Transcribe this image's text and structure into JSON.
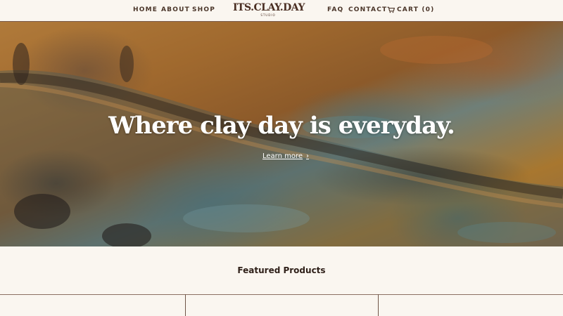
{
  "nav": {
    "home": "HOME",
    "about": "ABOUT",
    "shop": "SHOP",
    "faq": "FAQ",
    "contact": "CONTACT",
    "cart": "CART (0)",
    "cart_icon": "cart-icon"
  },
  "logo": {
    "wordmark": "ITS.CLAY.DAY",
    "sub": "STUDIO"
  },
  "hero": {
    "title": "Where clay day is everyday.",
    "link": "Learn more",
    "link_chevron": "›"
  },
  "featured": {
    "title": "Featured Products"
  },
  "colors": {
    "background": "#faf6f0",
    "nav_text": "#4a3529",
    "hero_text": "#ffffff"
  }
}
